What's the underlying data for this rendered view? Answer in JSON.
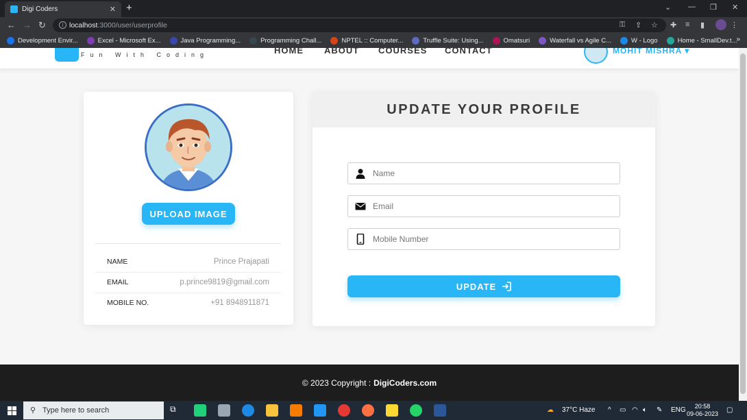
{
  "browser": {
    "tab_title": "Digi Coders",
    "url_host": "localhost",
    "url_path": ":3000/user/userprofile",
    "bookmarks": [
      {
        "label": "Development Envir...",
        "color": "#1a73e8"
      },
      {
        "label": "Excel - Microsoft Ex...",
        "color": "#7b3fb3"
      },
      {
        "label": "Java Programming...",
        "color": "#3949ab"
      },
      {
        "label": "Programming Chall...",
        "color": "#37474f"
      },
      {
        "label": "NPTEL :: Computer...",
        "color": "#d84315"
      },
      {
        "label": "Truffle Suite: Using...",
        "color": "#5c6bc0"
      },
      {
        "label": "Omatsuri",
        "color": "#ad1457"
      },
      {
        "label": "Waterfall vs Agile C...",
        "color": "#7e57c2"
      },
      {
        "label": "W - Logo",
        "color": "#1e88e5"
      },
      {
        "label": "Home - SmallDev.t...",
        "color": "#26a69a"
      }
    ],
    "more": "»"
  },
  "site": {
    "logo_tag": "Fun With Coding",
    "nav": [
      "HOME",
      "ABOUT",
      "COURSES",
      "CONTACT"
    ],
    "user_name": "MOHIT MISHRA",
    "user_caret": "▾"
  },
  "profile": {
    "upload_label": "UPLOAD IMAGE",
    "rows": [
      {
        "key": "NAME",
        "value": "Prince Prajapati"
      },
      {
        "key": "EMAIL",
        "value": "p.prince9819@gmail.com"
      },
      {
        "key": "MOBILE NO.",
        "value": "+91 8948911871"
      }
    ]
  },
  "form": {
    "title": "UPDATE YOUR PROFILE",
    "name_placeholder": "Name",
    "email_placeholder": "Email",
    "mobile_placeholder": "Mobile Number",
    "name_value": "",
    "email_value": "",
    "mobile_value": "",
    "update_label": "UPDATE"
  },
  "footer": {
    "text": "© 2023 Copyright :",
    "brand": "DigiCoders.com"
  },
  "taskbar": {
    "search_placeholder": "Type here to search",
    "weather": "37°C  Haze",
    "lang": "ENG",
    "time": "20:58",
    "date": "09-06-2023"
  },
  "colors": {
    "accent": "#29b6f6",
    "footer_bg": "#1d1d1d",
    "avatar_border": "#3b6fc6"
  }
}
